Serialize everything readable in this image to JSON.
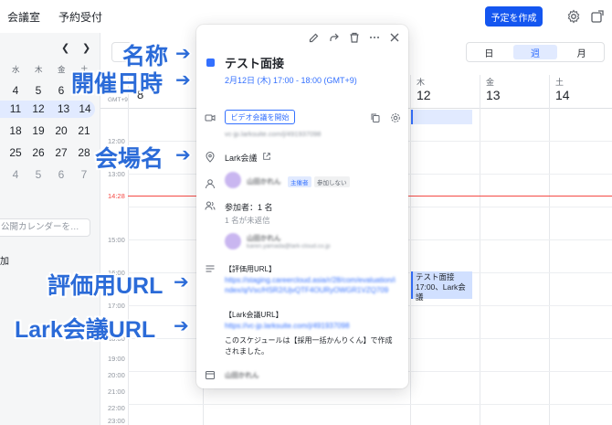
{
  "topnav": {
    "rooms": "会議室",
    "reservations": "予約受付",
    "create": "予定を作成"
  },
  "sidebar": {
    "weekdays": [
      "水",
      "木",
      "金",
      "土",
      "日"
    ],
    "rows": [
      [
        "4",
        "5",
        "6",
        "7"
      ],
      [
        "11",
        "12",
        "13",
        "14"
      ],
      [
        "18",
        "19",
        "20",
        "21"
      ],
      [
        "25",
        "26",
        "27",
        "28"
      ],
      [
        "4",
        "5",
        "6",
        "7"
      ]
    ],
    "search_placeholder": "公開カレンダーを…",
    "add": "加"
  },
  "view": {
    "day": "日",
    "week": "週",
    "month": "月"
  },
  "week": {
    "tz": "GMT+9",
    "first_day": "8",
    "days": [
      {
        "dow": "木",
        "num": "12"
      },
      {
        "dow": "金",
        "num": "13"
      },
      {
        "dow": "土",
        "num": "14"
      }
    ],
    "times": [
      "12:00",
      "13:00",
      "15:00",
      "16:00",
      "17:00",
      "18:00",
      "19:00",
      "20:00",
      "21:00",
      "22:00",
      "23:00"
    ],
    "now": "14:28",
    "event": {
      "title": "テスト面接",
      "location": "17:00、Lark会議"
    }
  },
  "popup": {
    "title": "テスト面接",
    "date": "2月12日 (木) 17:00 - 18:00 (GMT+9)",
    "video_button": "ビデオ会議を開始",
    "video_link": "vc-jp.larksuite.com/j/491937098",
    "location": "Lark会議",
    "organizer_name": "山田かれん",
    "organizer_badge": "主催者",
    "organizer_status": "参加しない",
    "participants": "参加者：1 名",
    "unanswered": "1 名が未返信",
    "participant_name": "山田かれん",
    "participant_email": "karen.yamada@lark-cloud.co.jp",
    "desc_eval_label": "【評価用URL】",
    "desc_eval_link": "https://staging.careercloud.asia/r/28/com/evaluation/index/q/Vsc/HSR2/UjvQTF4OURyOWGR1VZQ709",
    "desc_lark_label": "【Lark会議URL】",
    "desc_lark_link": "https://vc-jp.larksuite.com/j/491937098",
    "desc_footer": "このスケジュールは【採用一括かんりくん】で作成されました。",
    "calendar_owner": "山田かれん"
  },
  "annotations": {
    "name": "名称",
    "datetime": "開催日時",
    "venue": "会場名",
    "eval_url": "評価用URL",
    "lark_url": "Lark会議URL",
    "arrow": "➔"
  },
  "colors": {
    "brand": "#1456f0",
    "accent": "#3370ff",
    "now": "#f54a45",
    "annotation": "#2b6bd8"
  }
}
